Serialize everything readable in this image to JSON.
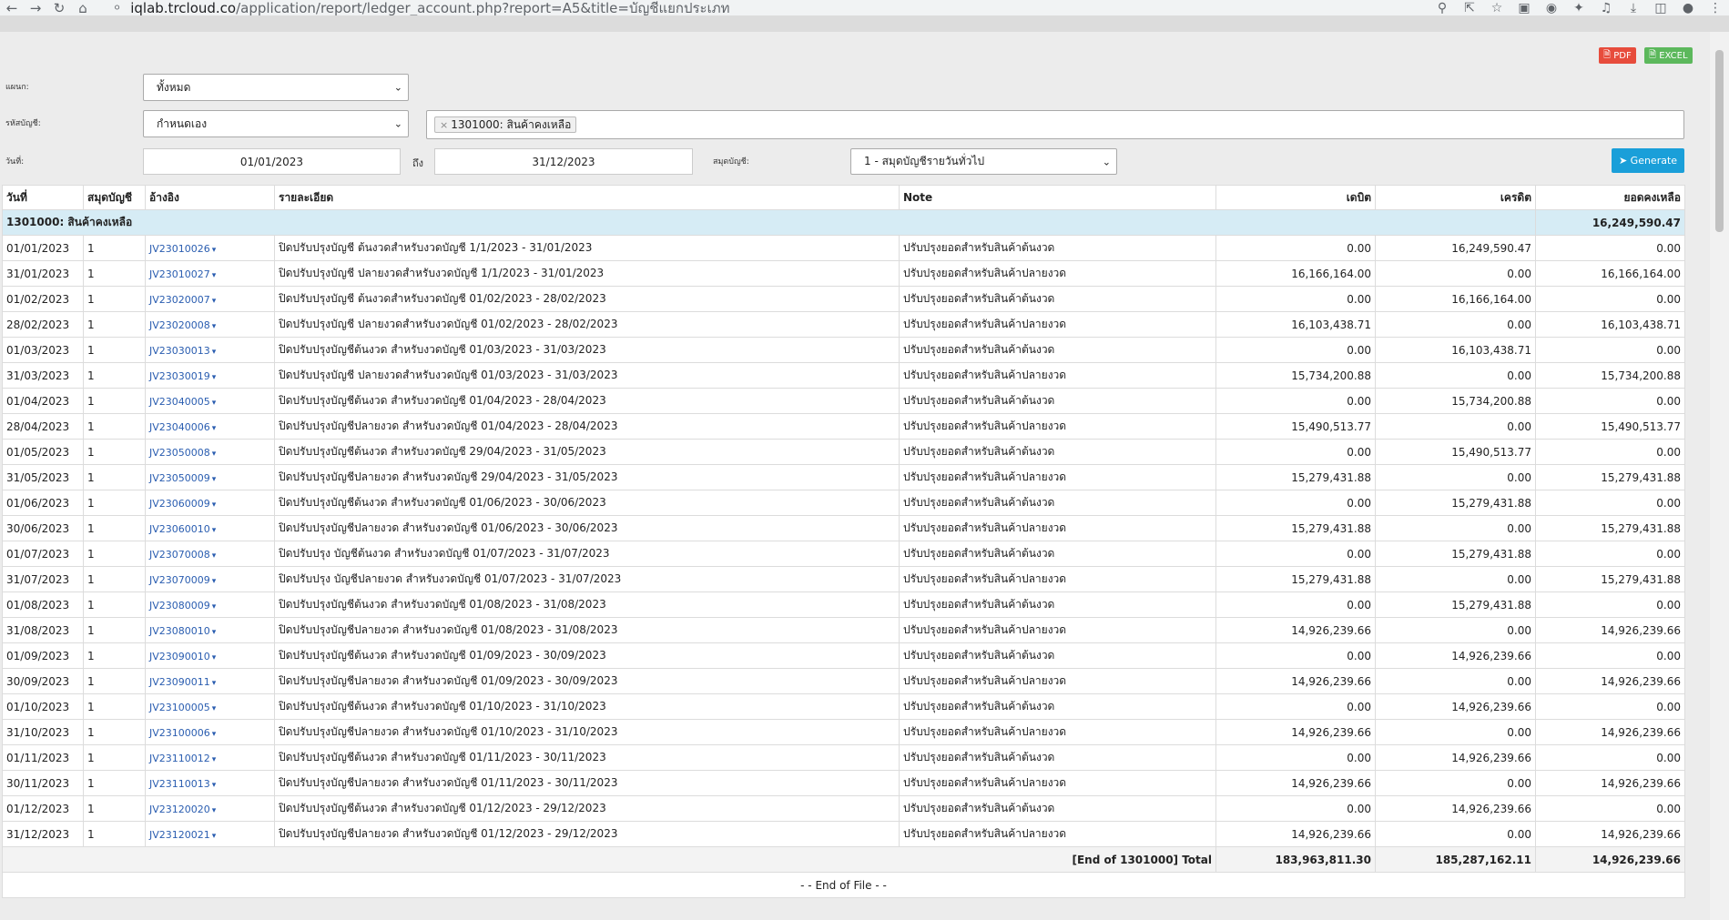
{
  "browser": {
    "url_domain": "iqlab.trcloud.co",
    "url_path": "/application/report/ledger_account.php?report=A5&title=บัญชีแยกประเภท"
  },
  "toolbar": {
    "pdf_label": "PDF",
    "excel_label": "EXCEL"
  },
  "filters": {
    "branch_label": "แผนก:",
    "branch_value": "ทั้งหมด",
    "account_label": "รหัสบัญชี:",
    "account_value": "กำหนดเอง",
    "account_tag": "1301000: สินค้าคงเหลือ",
    "date_label": "วันที่:",
    "date_from": "01/01/2023",
    "to_label": "ถึง",
    "date_to": "31/12/2023",
    "journal_label": "สมุดบัญชี:",
    "journal_value": "1 - สมุดบัญชีรายวันทั่วไป",
    "generate_label": "Generate"
  },
  "table": {
    "headers": [
      "วันที่",
      "สมุดบัญชี",
      "อ้างอิง",
      "รายละเอียด",
      "Note",
      "เดบิต",
      "เครดิต",
      "ยอดคงเหลือ"
    ],
    "group_label": "1301000: สินค้าคงเหลือ",
    "group_balance": "16,249,590.47",
    "rows": [
      [
        "01/01/2023",
        "1",
        "JV23010026",
        "ปิดปรับปรุงบัญชี ต้นงวดสำหรับงวดบัญชี 1/1/2023 - 31/01/2023",
        "ปรับปรุงยอดสำหรับสินค้าต้นงวด",
        "0.00",
        "16,249,590.47",
        "0.00"
      ],
      [
        "31/01/2023",
        "1",
        "JV23010027",
        "ปิดปรับปรุงบัญชี ปลายงวดสำหรับงวดบัญชี 1/1/2023 - 31/01/2023",
        "ปรับปรุงยอดสำหรับสินค้าปลายงวด",
        "16,166,164.00",
        "0.00",
        "16,166,164.00"
      ],
      [
        "01/02/2023",
        "1",
        "JV23020007",
        "ปิดปรับปรุงบัญชี ต้นงวดสำหรับงวดบัญชี 01/02/2023 - 28/02/2023",
        "ปรับปรุงยอดสำหรับสินค้าต้นงวด",
        "0.00",
        "16,166,164.00",
        "0.00"
      ],
      [
        "28/02/2023",
        "1",
        "JV23020008",
        "ปิดปรับปรุงบัญชี ปลายงวดสำหรับงวดบัญชี 01/02/2023 - 28/02/2023",
        "ปรับปรุงยอดสำหรับสินค้าปลายงวด",
        "16,103,438.71",
        "0.00",
        "16,103,438.71"
      ],
      [
        "01/03/2023",
        "1",
        "JV23030013",
        "ปิดปรับปรุงบัญชีต้นงวด สำหรับงวดบัญชี 01/03/2023 - 31/03/2023",
        "ปรับปรุงยอดสำหรับสินค้าต้นงวด",
        "0.00",
        "16,103,438.71",
        "0.00"
      ],
      [
        "31/03/2023",
        "1",
        "JV23030019",
        "ปิดปรับปรุงบัญชี ปลายงวดสำหรับงวดบัญชี 01/03/2023 - 31/03/2023",
        "ปรับปรุงยอดสำหรับสินค้าปลายงวด",
        "15,734,200.88",
        "0.00",
        "15,734,200.88"
      ],
      [
        "01/04/2023",
        "1",
        "JV23040005",
        "ปิดปรับปรุงบัญชีต้นงวด สำหรับงวดบัญชี 01/04/2023 - 28/04/2023",
        "ปรับปรุงยอดสำหรับสินค้าต้นงวด",
        "0.00",
        "15,734,200.88",
        "0.00"
      ],
      [
        "28/04/2023",
        "1",
        "JV23040006",
        "ปิดปรับปรุงบัญชีปลายงวด สำหรับงวดบัญชี 01/04/2023 - 28/04/2023",
        "ปรับปรุงยอดสำหรับสินค้าปลายงวด",
        "15,490,513.77",
        "0.00",
        "15,490,513.77"
      ],
      [
        "01/05/2023",
        "1",
        "JV23050008",
        "ปิดปรับปรุงบัญชีต้นงวด สำหรับงวดบัญชี 29/04/2023 - 31/05/2023",
        "ปรับปรุงยอดสำหรับสินค้าต้นงวด",
        "0.00",
        "15,490,513.77",
        "0.00"
      ],
      [
        "31/05/2023",
        "1",
        "JV23050009",
        "ปิดปรับปรุงบัญชีปลายงวด สำหรับงวดบัญชี 29/04/2023 - 31/05/2023",
        "ปรับปรุงยอดสำหรับสินค้าปลายงวด",
        "15,279,431.88",
        "0.00",
        "15,279,431.88"
      ],
      [
        "01/06/2023",
        "1",
        "JV23060009",
        "ปิดปรับปรุงบัญชีต้นงวด สำหรับงวดบัญชี 01/06/2023 - 30/06/2023",
        "ปรับปรุงยอดสำหรับสินค้าต้นงวด",
        "0.00",
        "15,279,431.88",
        "0.00"
      ],
      [
        "30/06/2023",
        "1",
        "JV23060010",
        "ปิดปรับปรุงบัญชีปลายงวด สำหรับงวดบัญชี 01/06/2023 - 30/06/2023",
        "ปรับปรุงยอดสำหรับสินค้าปลายงวด",
        "15,279,431.88",
        "0.00",
        "15,279,431.88"
      ],
      [
        "01/07/2023",
        "1",
        "JV23070008",
        "ปิดปรับปรุง บัญชีต้นงวด สำหรับงวดบัญชี 01/07/2023 - 31/07/2023",
        "ปรับปรุงยอดสำหรับสินค้าต้นงวด",
        "0.00",
        "15,279,431.88",
        "0.00"
      ],
      [
        "31/07/2023",
        "1",
        "JV23070009",
        "ปิดปรับปรุง บัญชีปลายงวด สำหรับงวดบัญชี 01/07/2023 - 31/07/2023",
        "ปรับปรุงยอดสำหรับสินค้าปลายงวด",
        "15,279,431.88",
        "0.00",
        "15,279,431.88"
      ],
      [
        "01/08/2023",
        "1",
        "JV23080009",
        "ปิดปรับปรุงบัญชีต้นงวด สำหรับงวดบัญชี 01/08/2023 - 31/08/2023",
        "ปรับปรุงยอดสำหรับสินค้าต้นงวด",
        "0.00",
        "15,279,431.88",
        "0.00"
      ],
      [
        "31/08/2023",
        "1",
        "JV23080010",
        "ปิดปรับปรุงบัญชีปลายงวด สำหรับงวดบัญชี 01/08/2023 - 31/08/2023",
        "ปรับปรุงยอดสำหรับสินค้าปลายงวด",
        "14,926,239.66",
        "0.00",
        "14,926,239.66"
      ],
      [
        "01/09/2023",
        "1",
        "JV23090010",
        "ปิดปรับปรุงบัญชีต้นงวด สำหรับงวดบัญชี 01/09/2023 - 30/09/2023",
        "ปรับปรุงยอดสำหรับสินค้าต้นงวด",
        "0.00",
        "14,926,239.66",
        "0.00"
      ],
      [
        "30/09/2023",
        "1",
        "JV23090011",
        "ปิดปรับปรุงบัญชีปลายงวด สำหรับงวดบัญชี 01/09/2023 - 30/09/2023",
        "ปรับปรุงยอดสำหรับสินค้าปลายงวด",
        "14,926,239.66",
        "0.00",
        "14,926,239.66"
      ],
      [
        "01/10/2023",
        "1",
        "JV23100005",
        "ปิดปรับปรุงบัญชีต้นงวด สำหรับงวดบัญชี 01/10/2023 - 31/10/2023",
        "ปรับปรุงยอดสำหรับสินค้าต้นงวด",
        "0.00",
        "14,926,239.66",
        "0.00"
      ],
      [
        "31/10/2023",
        "1",
        "JV23100006",
        "ปิดปรับปรุงบัญชีปลายงวด สำหรับงวดบัญชี 01/10/2023 - 31/10/2023",
        "ปรับปรุงยอดสำหรับสินค้าปลายงวด",
        "14,926,239.66",
        "0.00",
        "14,926,239.66"
      ],
      [
        "01/11/2023",
        "1",
        "JV23110012",
        "ปิดปรับปรุงบัญชีต้นงวด สำหรับงวดบัญชี 01/11/2023 - 30/11/2023",
        "ปรับปรุงยอดสำหรับสินค้าต้นงวด",
        "0.00",
        "14,926,239.66",
        "0.00"
      ],
      [
        "30/11/2023",
        "1",
        "JV23110013",
        "ปิดปรับปรุงบัญชีปลายงวด สำหรับงวดบัญชี 01/11/2023 - 30/11/2023",
        "ปรับปรุงยอดสำหรับสินค้าปลายงวด",
        "14,926,239.66",
        "0.00",
        "14,926,239.66"
      ],
      [
        "01/12/2023",
        "1",
        "JV23120020",
        "ปิดปรับปรุงบัญชีต้นงวด สำหรับงวดบัญชี 01/12/2023 - 29/12/2023",
        "ปรับปรุงยอดสำหรับสินค้าต้นงวด",
        "0.00",
        "14,926,239.66",
        "0.00"
      ],
      [
        "31/12/2023",
        "1",
        "JV23120021",
        "ปิดปรับปรุงบัญชีปลายงวด สำหรับงวดบัญชี 01/12/2023 - 29/12/2023",
        "ปรับปรุงยอดสำหรับสินค้าปลายงวด",
        "14,926,239.66",
        "0.00",
        "14,926,239.66"
      ]
    ],
    "total_label": "[End of 1301000]  Total",
    "total_debit": "183,963,811.30",
    "total_credit": "185,287,162.11",
    "total_balance": "14,926,239.66",
    "eof_label": "- - End of File - -"
  },
  "colors": {
    "accent": "#1a9fd9",
    "pdf": "#e74c3c",
    "excel": "#5cb85c",
    "group_row": "#d6ecf5",
    "link": "#2a5db0"
  }
}
